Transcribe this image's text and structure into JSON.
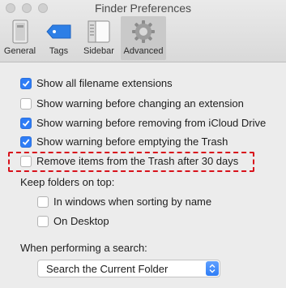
{
  "window": {
    "title": "Finder Preferences"
  },
  "toolbar": {
    "tabs": [
      {
        "label": "General",
        "icon": "general-icon"
      },
      {
        "label": "Tags",
        "icon": "tag-icon"
      },
      {
        "label": "Sidebar",
        "icon": "sidebar-icon"
      },
      {
        "label": "Advanced",
        "icon": "gear-icon",
        "selected": true
      }
    ]
  },
  "options": [
    {
      "label": "Show all filename extensions",
      "checked": true
    },
    {
      "label": "Show warning before changing an extension",
      "checked": false
    },
    {
      "label": "Show warning before removing from iCloud Drive",
      "checked": true
    },
    {
      "label": "Show warning before emptying the Trash",
      "checked": true
    },
    {
      "label": "Remove items from the Trash after 30 days",
      "checked": false,
      "highlighted": true
    }
  ],
  "folders_on_top": {
    "heading": "Keep folders on top:",
    "items": [
      {
        "label": "In windows when sorting by name",
        "checked": false
      },
      {
        "label": "On Desktop",
        "checked": false
      }
    ]
  },
  "search": {
    "heading": "When performing a search:",
    "selected": "Search the Current Folder"
  },
  "colors": {
    "accent": "#2f7df6",
    "highlight": "#d8121b"
  }
}
